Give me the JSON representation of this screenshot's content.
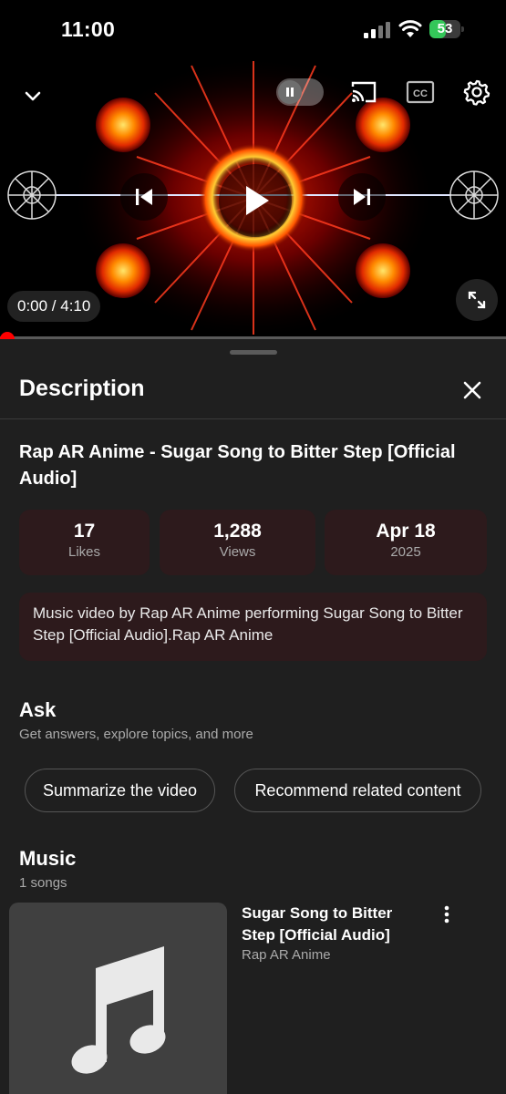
{
  "status_bar": {
    "time": "11:00",
    "battery": "53",
    "battery_level": 0.53,
    "icons": [
      "signal-icon",
      "wifi-icon",
      "battery-icon"
    ]
  },
  "player": {
    "time_display": "0:00 / 4:10",
    "progress_fraction": 0.0,
    "autoplay_on": false,
    "cc_label": "CC",
    "icons": [
      "chevron-down-icon",
      "pause-icon",
      "cast-icon",
      "cc-icon",
      "gear-icon",
      "previous-icon",
      "play-icon",
      "next-icon",
      "fullscreen-icon"
    ]
  },
  "description": {
    "title": "Description",
    "video_title": "Rap AR Anime - Sugar Song to Bitter Step [Official Audio]",
    "stats": [
      {
        "value": "17",
        "label": "Likes"
      },
      {
        "value": "1,288",
        "label": "Views"
      },
      {
        "value": "Apr 18",
        "label": "2025"
      }
    ],
    "text": "Music video by Rap AR Anime performing Sugar Song to Bitter Step [Official Audio].Rap AR Anime"
  },
  "ask": {
    "title": "Ask",
    "subtitle": "Get answers, explore topics, and more",
    "chips": [
      "Summarize the video",
      "Recommend related content"
    ]
  },
  "music": {
    "title": "Music",
    "count": "1 songs",
    "songs": [
      {
        "title": "Sugar Song to Bitter Step [Official Audio]",
        "artist": "Rap AR Anime"
      }
    ]
  },
  "colors": {
    "background": "#1f1f1f",
    "card": "#2d1a1c",
    "accent_red": "#ff0000",
    "battery_green": "#34c759"
  }
}
